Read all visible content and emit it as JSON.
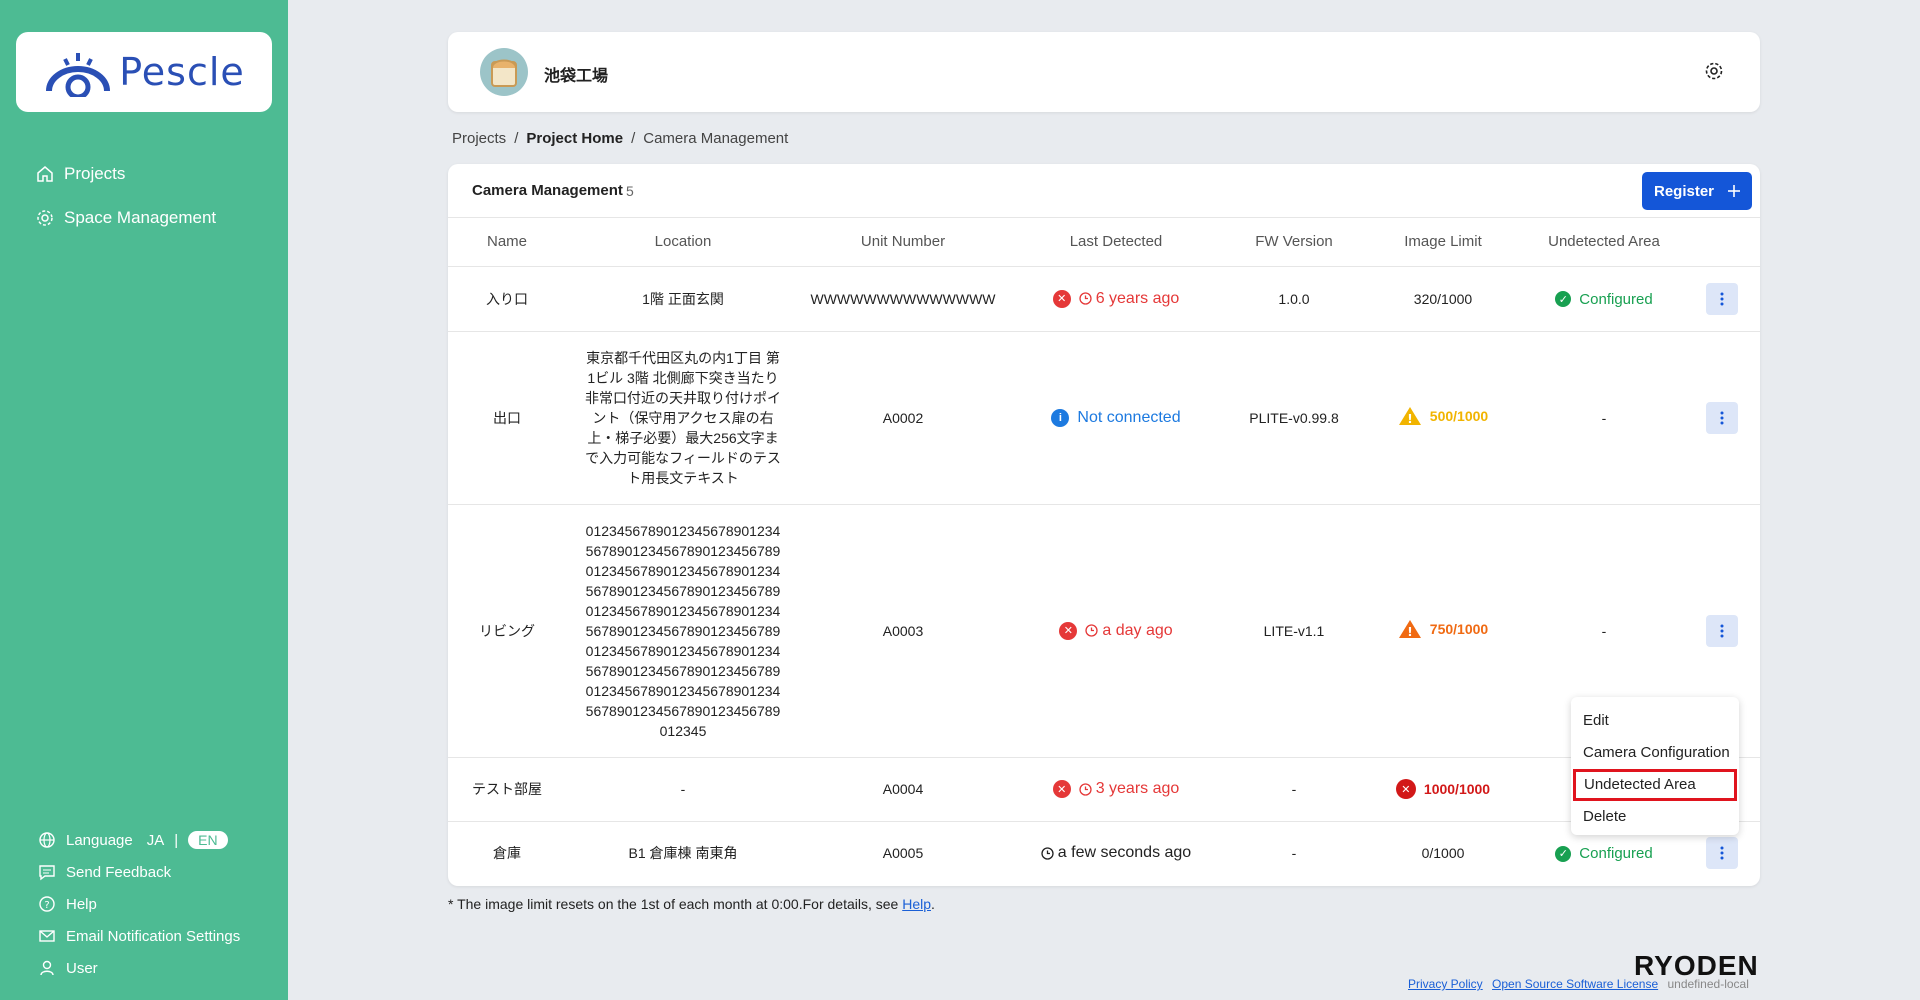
{
  "app": {
    "name": "Pescle"
  },
  "nav": {
    "projects": "Projects",
    "space_management": "Space Management"
  },
  "sidebar_bottom": {
    "language": "Language",
    "lang_ja": "JA",
    "lang_sep": "|",
    "lang_en": "EN",
    "send_feedback": "Send Feedback",
    "help": "Help",
    "email_settings": "Email Notification Settings",
    "user": "User"
  },
  "header": {
    "factory_name": "池袋工場"
  },
  "breadcrumb": {
    "projects": "Projects",
    "project_home": "Project Home",
    "current": "Camera Management",
    "sep": "/"
  },
  "card": {
    "title": "Camera Management",
    "count": "5",
    "register": "Register"
  },
  "table": {
    "columns": [
      "Name",
      "Location",
      "Unit Number",
      "Last Detected",
      "FW Version",
      "Image Limit",
      "Undetected Area"
    ],
    "rows": [
      {
        "name": "入り口",
        "location": "1階 正面玄関",
        "unit": "WWWWWWWWWWWWWW",
        "last_detected": "6 years ago",
        "fw": "1.0.0",
        "limit": "320/1000",
        "area": "Configured"
      },
      {
        "name": "出口",
        "location_lines": [
          "東京都千代田区丸の内1丁目 第",
          "1ビル 3階 北側廊下突き当たり",
          "非常口付近の天井取り付けポイ",
          "ント（保守用アクセス扉の右",
          "上・梯子必要）最大256文字ま",
          "で入力可能なフィールドのテス",
          "ト用長文テキスト"
        ],
        "unit": "A0002",
        "last_detected": "Not connected",
        "fw": "PLITE-v0.99.8",
        "limit": "500/1000",
        "area": "-"
      },
      {
        "name": "リビング",
        "location_lines": [
          "012345678901234567890123​4",
          "567890123456789012345678​9",
          "012345678901234567890123​4",
          "567890123456789012345678​9",
          "012345678901234567890123​4",
          "567890123456789012345678​9",
          "012345678901234567890123​4",
          "567890123456789012345678​9",
          "012345678901234567890123​4",
          "567890123456789012345678​9",
          "012345"
        ],
        "unit": "A0003",
        "last_detected": "a day ago",
        "fw": "LITE-v1.1",
        "limit": "750/1000",
        "area": "-"
      },
      {
        "name": "テスト部屋",
        "location": "-",
        "unit": "A0004",
        "last_detected": "3 years ago",
        "fw": "-",
        "limit": "1000/1000",
        "area": ""
      },
      {
        "name": "倉庫",
        "location": "B1 倉庫棟 南東角",
        "unit": "A0005",
        "last_detected": "a few seconds ago",
        "fw": "-",
        "limit": "0/1000",
        "area": "Configured"
      }
    ]
  },
  "menu": {
    "edit": "Edit",
    "camera_config": "Camera Configuration",
    "undetected_area": "Undetected Area",
    "delete": "Delete"
  },
  "footnote": {
    "text": "* The image limit resets on the 1st of each month at 0:00.For details, see ",
    "link": "Help",
    "end": "."
  },
  "footer": {
    "brand": "RYODEN",
    "privacy": "Privacy Policy",
    "oss": "Open Source Software License",
    "env": "undefined-local"
  },
  "colors": {
    "sidebar": "#4dbb93",
    "primary": "#1456d8",
    "error": "#e53838",
    "warning": "#f1b400",
    "success": "#18a051"
  }
}
